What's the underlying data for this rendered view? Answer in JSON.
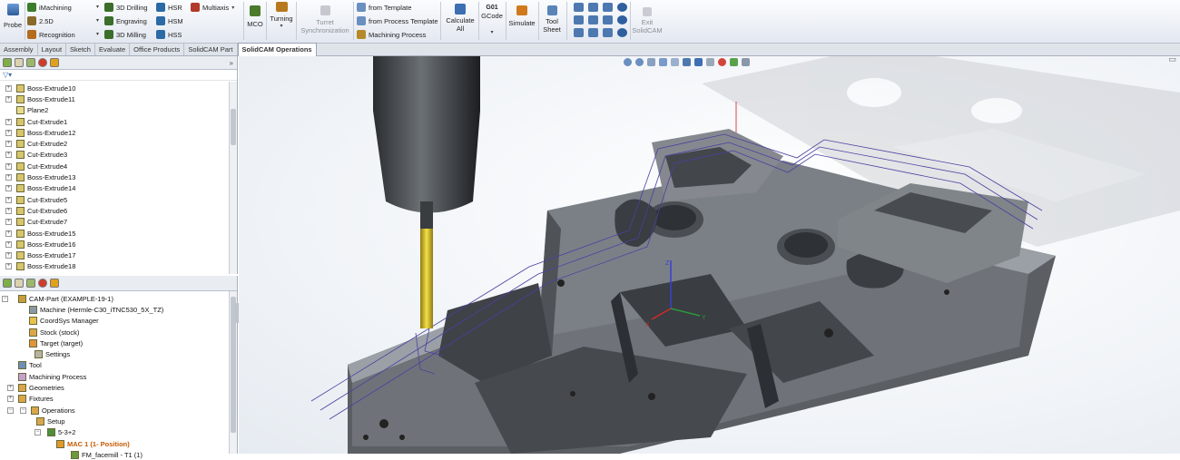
{
  "ribbon": {
    "probe": "Probe",
    "imachining": "iMachining",
    "twod": "2.5D",
    "recognition": "Recognition",
    "drilling3d": "3D Drilling",
    "engraving": "Engraving",
    "milling3d": "3D Milling",
    "hsr": "HSR",
    "hsm": "HSM",
    "hss": "HSS",
    "multiaxis": "Multiaxis",
    "mco": "MCO",
    "turning": "Turning",
    "turret_line1": "Turret",
    "turret_line2": "Synchronization",
    "from_template": "from Template",
    "from_process_template": "from Process Template",
    "machining_process": "Machining Process",
    "calculate_line1": "Calculate",
    "calculate_line2": "All",
    "gcode_top": "G01",
    "gcode": "GCode",
    "simulate": "Simulate",
    "toolsheet_line1": "Tool",
    "toolsheet_line2": "Sheet",
    "exit_line1": "Exit",
    "exit_line2": "SolidCAM"
  },
  "tabs": [
    "Assembly",
    "Layout",
    "Sketch",
    "Evaluate",
    "Office Products",
    "SolidCAM Part",
    "SolidCAM Operations"
  ],
  "feature_tree": [
    "Boss-Extrude10",
    "Boss-Extrude11",
    "Plane2",
    "Cut-Extrude1",
    "Boss-Extrude12",
    "Cut-Extrude2",
    "Cut-Extrude3",
    "Cut-Extrude4",
    "Boss-Extrude13",
    "Boss-Extrude14",
    "Cut-Extrude5",
    "Cut-Extrude6",
    "Cut-Extrude7",
    "Boss-Extrude15",
    "Boss-Extrude16",
    "Boss-Extrude17",
    "Boss-Extrude18"
  ],
  "cam_tree": {
    "root": "CAM-Part (EXAMPLE-19-1)",
    "machine": "Machine (Hermle-C30_iTNC530_5X_TZ)",
    "coordsys": "CoordSys Manager",
    "stock": "Stock (stock)",
    "target": "Target (target)",
    "settings": "Settings",
    "tool": "Tool",
    "machining_process": "Machining Process",
    "geometries": "Geometries",
    "fixtures": "Fixtures",
    "operations": "Operations",
    "setup": "Setup",
    "setup_sub": "5-3+2",
    "mac": "MAC 1 (1- Position)",
    "last_op": "FM_facemill - T1 (1)"
  },
  "axes": {
    "x": "X",
    "y": "Y",
    "z": "Z"
  },
  "colors": {
    "accent_tab": "#ffffff",
    "mac_orange": "#c65a00",
    "tool_gold": "#e7d12a",
    "part_grey": "#6f7379",
    "toolpath": "#4b3fa0"
  }
}
